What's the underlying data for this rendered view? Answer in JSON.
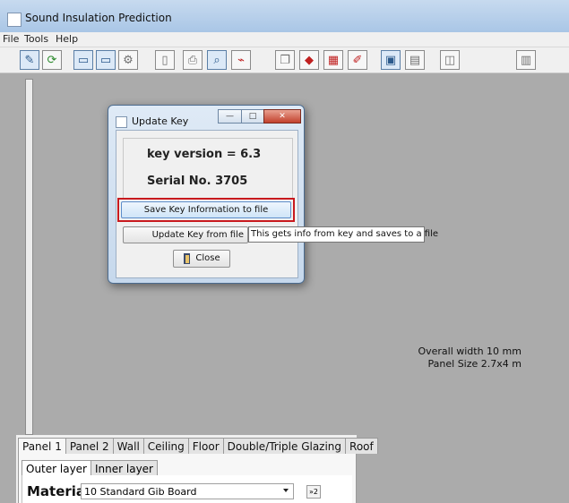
{
  "window": {
    "title": "Sound Insulation Prediction"
  },
  "menu": [
    "File",
    "Tools",
    "Help"
  ],
  "toolbar": {
    "buttons": [
      {
        "name": "pencil-tool-icon",
        "glyph": "✎",
        "tone": "blue"
      },
      {
        "name": "refresh-icon",
        "glyph": "⟳",
        "tone": "grn"
      },
      {
        "name": "graph-view-icon",
        "glyph": "▭",
        "tone": "blue"
      },
      {
        "name": "graph-compare-icon",
        "glyph": "▭",
        "tone": "blue"
      },
      {
        "name": "settings-gear-icon",
        "glyph": "⚙",
        "tone": "gray"
      },
      {
        "name": "new-document-icon",
        "glyph": "▯",
        "tone": "gray"
      },
      {
        "name": "print-icon",
        "glyph": "⎙",
        "tone": "gray"
      },
      {
        "name": "print-preview-icon",
        "glyph": "⌕",
        "tone": "blue"
      },
      {
        "name": "pdf-export-icon",
        "glyph": "⌁",
        "tone": "red"
      },
      {
        "name": "copy-report-icon",
        "glyph": "❐",
        "tone": "gray"
      },
      {
        "name": "data-export-icon",
        "glyph": "◆",
        "tone": "red"
      },
      {
        "name": "chart-export-icon",
        "glyph": "▦",
        "tone": "red"
      },
      {
        "name": "edit-pen-icon",
        "glyph": "✐",
        "tone": "red"
      },
      {
        "name": "save-icon",
        "glyph": "▣",
        "tone": "blue"
      },
      {
        "name": "open-folder-icon",
        "glyph": "▤",
        "tone": "gray"
      },
      {
        "name": "3d-box-icon",
        "glyph": "◫",
        "tone": "gray"
      },
      {
        "name": "calculator-icon",
        "glyph": "▥",
        "tone": "gray"
      }
    ]
  },
  "status": {
    "overall_width": "Overall width 10 mm",
    "panel_size": "Panel Size 2.7x4 m"
  },
  "tabs": [
    "Panel 1",
    "Panel 2",
    "Wall",
    "Ceiling",
    "Floor",
    "Double/Triple Glazing",
    "Roof"
  ],
  "subtabs": [
    "Outer layer",
    "Inner layer"
  ],
  "material": {
    "label": "Material",
    "value": "10 Standard Gib Board",
    "button": "»2"
  },
  "dialog": {
    "title": "Update Key",
    "window_buttons": {
      "minimize": "—",
      "maximize": "□",
      "close": "✕"
    },
    "key_version": "key version = 6.3",
    "serial": "Serial No. 3705",
    "save_button": "Save Key Information to file",
    "update_button": "Update Key from file",
    "tooltip": "This gets info from key and saves to a file",
    "close_button": "Close"
  },
  "colors": {
    "highlight_border": "#c8191e",
    "workspace": "#ababab"
  }
}
